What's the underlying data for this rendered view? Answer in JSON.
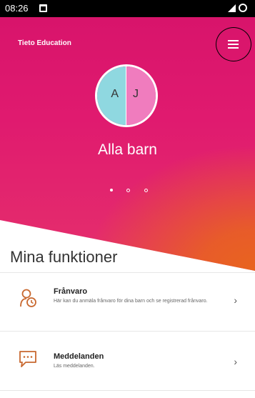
{
  "status_bar": {
    "time": "08:26"
  },
  "header": {
    "brand": "Tieto Education"
  },
  "carousel": {
    "child_initials": [
      "A",
      "J"
    ],
    "child_name": "Alla barn",
    "colors": {
      "left": "#8fd8e0",
      "right": "#f07cbe"
    }
  },
  "section": {
    "title": "Mina funktioner"
  },
  "functions": [
    {
      "title": "Frånvaro",
      "description": "Här kan du anmäla frånvaro för dina barn och se registrerad frånvaro.",
      "icon": "person-clock-icon"
    },
    {
      "title": "Meddelanden",
      "description": "Läs meddelanden.",
      "icon": "chat-bubble-icon"
    }
  ],
  "theme": {
    "accent": "#e0186e",
    "accent_secondary": "#e8641e",
    "icon_color": "#c8682f"
  }
}
